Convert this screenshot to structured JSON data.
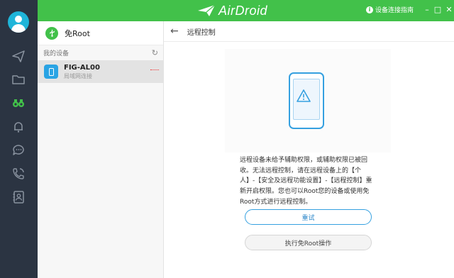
{
  "app": {
    "name": "AirDroid"
  },
  "topbar": {
    "connection_guide": "设备连接指南",
    "min_label": "–",
    "max_label": "□",
    "close_label": "✕"
  },
  "rail": {
    "icons": [
      "avatar",
      "send-icon",
      "folder-icon",
      "binoculars-icon",
      "bell-icon",
      "chat-icon",
      "phone-call-icon",
      "contacts-icon"
    ]
  },
  "device_panel": {
    "no_root_label": "免Root",
    "my_devices_label": "我的设备",
    "refresh_icon": "↻",
    "devices": [
      {
        "name": "FIG-AL00",
        "status": "局域网连接"
      }
    ]
  },
  "main": {
    "back_icon": "←",
    "title": "远程控制",
    "message": "远程设备未给予辅助权限，或辅助权限已被回收。无法远程控制，请在远程设备上的【个人】-【安全及远程功能设置】-【远程控制】重新开启权限。您也可以Root您的设备或使用免Root方式进行远程控制。",
    "retry_button": "重试",
    "noroot_button": "执行免Root操作"
  },
  "colors": {
    "brand_green": "#42c14a",
    "rail_dark": "#2b3442",
    "accent_blue": "#35a0e0"
  }
}
